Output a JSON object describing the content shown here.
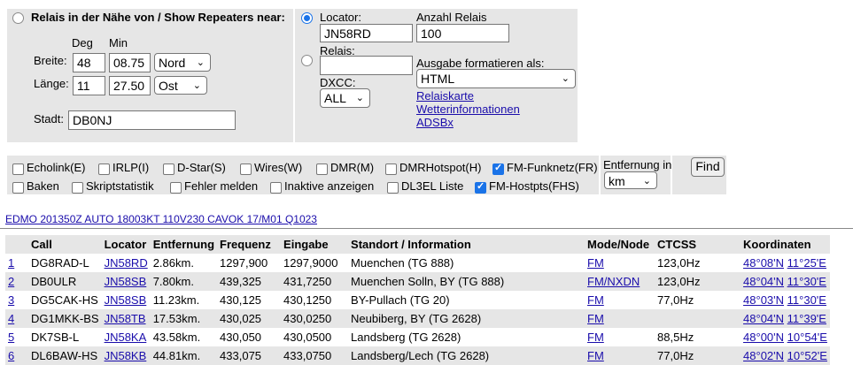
{
  "search_near": {
    "heading": "Relais in der Nähe von / Show Repeaters near:",
    "deg_label": "Deg",
    "min_label": "Min",
    "breite_label": "Breite:",
    "breite_deg": "48",
    "breite_min": "08.75",
    "breite_dir": "Nord",
    "laenge_label": "Länge:",
    "laenge_deg": "11",
    "laenge_min": "27.50",
    "laenge_dir": "Ost",
    "stadt_label": "Stadt:",
    "stadt_value": "DB0NJ"
  },
  "locator_panel": {
    "locator_label": "Locator:",
    "locator_value": "JN58RD",
    "relais_label": "Relais:",
    "relais_value": "",
    "dxcc_label": "DXCC:",
    "dxcc_value": "ALL",
    "anzahl_label": "Anzahl Relais",
    "anzahl_value": "100",
    "ausgabe_label": "Ausgabe formatieren als:",
    "ausgabe_value": "HTML",
    "links": [
      "Relaiskarte",
      "Wetterinformationen",
      "ADSBx"
    ]
  },
  "filters": {
    "row1": [
      {
        "label": "Echolink(E)",
        "checked": false
      },
      {
        "label": "IRLP(I)",
        "checked": false
      },
      {
        "label": "D-Star(S)",
        "checked": false
      },
      {
        "label": "Wires(W)",
        "checked": false
      },
      {
        "label": "DMR(M)",
        "checked": false
      },
      {
        "label": "DMRHotspot(H)",
        "checked": false
      },
      {
        "label": "FM-Funknetz(FR)",
        "checked": true
      }
    ],
    "row2": [
      {
        "label": "Baken",
        "checked": false
      },
      {
        "label": "Skriptstatistik",
        "checked": false
      },
      {
        "label": "Fehler melden",
        "checked": false
      },
      {
        "label": "Inaktive anzeigen",
        "checked": false
      },
      {
        "label": "DL3EL Liste",
        "checked": false
      },
      {
        "label": "FM-Hostpts(FHS)",
        "checked": true
      }
    ],
    "entfernung_label": "Entfernung in",
    "entfernung_unit": "km",
    "find_label": "Find"
  },
  "metar": "EDMO 201350Z AUTO 18003KT 110V230 CAVOK 17/M01 Q1023",
  "table": {
    "headers": [
      "",
      "Call",
      "Locator",
      "Entfernung",
      "Frequenz",
      "Eingabe",
      "Standort / Information",
      "Mode/Node",
      "CTCSS",
      "Koordinaten"
    ],
    "rows": [
      {
        "n": "1",
        "call": "DG8RAD-L",
        "loc": "JN58RD",
        "dist": "2.86km.",
        "freq": "1297,900",
        "input": "1297,9000",
        "site": "Muenchen (TG 888)",
        "mode": "FM",
        "ctcss": "123,0Hz",
        "lat": "48°08'N",
        "lon": "11°25'E"
      },
      {
        "n": "2",
        "call": "DB0ULR",
        "loc": "JN58SB",
        "dist": "7.80km.",
        "freq": "439,325",
        "input": "431,7250",
        "site": "Muenchen Solln, BY (TG 888)",
        "mode": "FM/NXDN",
        "ctcss": "123,0Hz",
        "lat": "48°04'N",
        "lon": "11°30'E"
      },
      {
        "n": "3",
        "call": "DG5CAK-HS",
        "loc": "JN58SB",
        "dist": "11.23km.",
        "freq": "430,125",
        "input": "430,1250",
        "site": "BY-Pullach (TG 20)",
        "mode": "FM",
        "ctcss": "77,0Hz",
        "lat": "48°03'N",
        "lon": "11°30'E"
      },
      {
        "n": "4",
        "call": "DG1MKK-BS",
        "loc": "JN58TB",
        "dist": "17.53km.",
        "freq": "430,025",
        "input": "430,0250",
        "site": "Neubiberg, BY (TG 2628)",
        "mode": "FM",
        "ctcss": "",
        "lat": "48°04'N",
        "lon": "11°39'E"
      },
      {
        "n": "5",
        "call": "DK7SB-L",
        "loc": "JN58KA",
        "dist": "43.58km.",
        "freq": "430,050",
        "input": "430,0500",
        "site": "Landsberg (TG 2628)",
        "mode": "FM",
        "ctcss": "88,5Hz",
        "lat": "48°00'N",
        "lon": "10°54'E"
      },
      {
        "n": "6",
        "call": "DL6BAW-HS",
        "loc": "JN58KB",
        "dist": "44.81km.",
        "freq": "433,075",
        "input": "433,0750",
        "site": "Landsberg/Lech (TG 2628)",
        "mode": "FM",
        "ctcss": "77,0Hz",
        "lat": "48°02'N",
        "lon": "10°52'E"
      }
    ]
  }
}
